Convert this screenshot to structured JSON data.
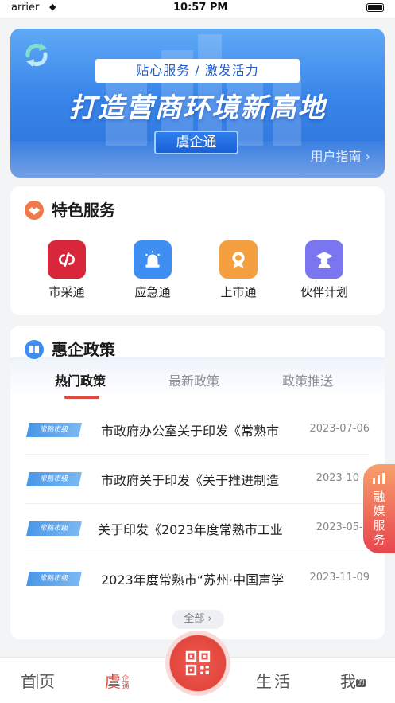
{
  "status_bar": {
    "carrier": "arrier",
    "time": "10:57 PM"
  },
  "banner": {
    "ribbon": "贴心服务 / 激发活力",
    "headline": "打造营商环境新高地",
    "tag": "虞企通",
    "guide_link": "用户指南 ›"
  },
  "services": {
    "title": "特色服务",
    "items": [
      {
        "label": "市采通",
        "icon": "link-icon",
        "color": "#d8263a"
      },
      {
        "label": "应急通",
        "icon": "alarm-icon",
        "color": "#3d8ef0"
      },
      {
        "label": "上市通",
        "icon": "award-icon",
        "color": "#f4a041"
      },
      {
        "label": "伙伴计划",
        "icon": "graduate-icon",
        "color": "#7a76f0"
      }
    ]
  },
  "policy": {
    "title": "惠企政策",
    "tabs": [
      "热门政策",
      "最新政策",
      "政策推送"
    ],
    "active_tab": 0,
    "rows": [
      {
        "badge": "常熟市级",
        "title": "市政府办公室关于印发《常熟市",
        "date": "2023-07-06"
      },
      {
        "badge": "常熟市级",
        "title": "市政府关于印发《关于推进制造",
        "date": "2023-10-1"
      },
      {
        "badge": "常熟市级",
        "title": "关于印发《2023年度常熟市工业",
        "date": "2023-05-2"
      },
      {
        "badge": "常熟市级",
        "title": "2023年度常熟市“苏州·中国声学",
        "date": "2023-11-09"
      }
    ],
    "more_button": "全部 ›"
  },
  "float_side": {
    "label": "融媒服务"
  },
  "tabbar": {
    "home": [
      "首",
      "页"
    ],
    "yu": "虞",
    "yu_small": "企通",
    "life": [
      "生",
      "活"
    ],
    "me": "我",
    "me_small": "的"
  },
  "colors": {
    "accent": "#e2463c",
    "brand_blue": "#2a6fd9"
  }
}
